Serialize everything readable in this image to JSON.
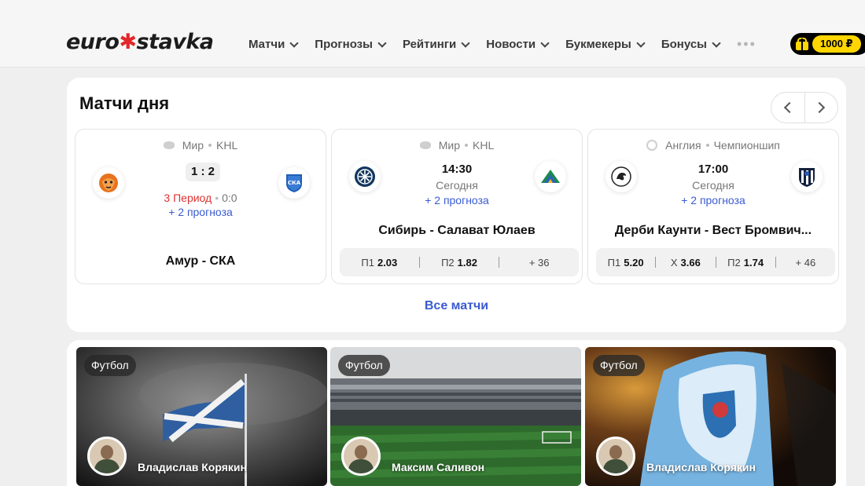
{
  "header": {
    "logo": {
      "part1": "euro",
      "star": "✱",
      "part2": "stavka"
    },
    "nav": [
      {
        "label": "Матчи"
      },
      {
        "label": "Прогнозы"
      },
      {
        "label": "Рейтинги"
      },
      {
        "label": "Новости"
      },
      {
        "label": "Букмекеры"
      },
      {
        "label": "Бонусы"
      }
    ],
    "more": "•••",
    "bonus_amount": "1000 ₽",
    "bonus_icon": "gift-icon"
  },
  "matches": {
    "title": "Матчи дня",
    "all_label": "Все матчи",
    "cards": [
      {
        "country": "Мир",
        "league": "KHL",
        "sport_icon": "hockey-puck-icon",
        "score": "1 : 2",
        "period": "3 Период",
        "period_score": "0:0",
        "forecasts": "+ 2 прогноза",
        "name": "Амур - СКА"
      },
      {
        "country": "Мир",
        "league": "KHL",
        "sport_icon": "hockey-puck-icon",
        "time": "14:30",
        "day": "Сегодня",
        "forecasts": "+ 2 прогноза",
        "name": "Сибирь - Салават Юлаев",
        "odds": {
          "p1_label": "П1",
          "p1": "2.03",
          "p2_label": "П2",
          "p2": "1.82",
          "more": "+ 36"
        }
      },
      {
        "country": "Англия",
        "league": "Чемпионшип",
        "sport_icon": "soccer-ball-icon",
        "time": "17:00",
        "day": "Сегодня",
        "forecasts": "+ 2 прогноза",
        "name": "Дерби Каунти - Вест Бромвич...",
        "odds": {
          "p1_label": "П1",
          "p1": "5.20",
          "x_label": "Х",
          "x": "3.66",
          "p2_label": "П2",
          "p2": "1.74",
          "more": "+ 46"
        }
      }
    ]
  },
  "news": [
    {
      "category": "Футбол",
      "author": "Владислав Корякин"
    },
    {
      "category": "Футбол",
      "author": "Максим Саливон"
    },
    {
      "category": "Футбол",
      "author": "Владислав Корякин"
    }
  ],
  "colors": {
    "accent_yellow": "#ffd600",
    "link_blue": "#3a5bd0",
    "live_red": "#e03232"
  }
}
